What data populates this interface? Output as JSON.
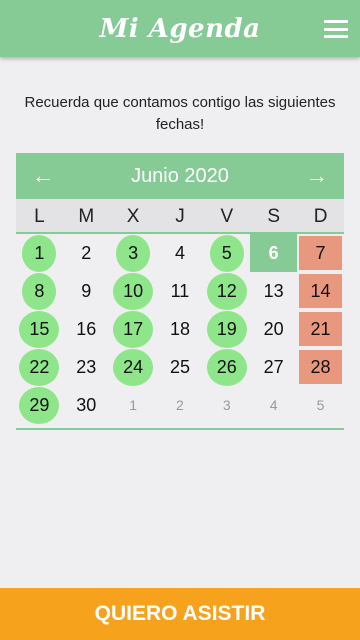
{
  "header": {
    "title": "Mi Agenda",
    "menu_icon": "hamburger-menu-icon"
  },
  "intro": "Recuerda que contamos contigo las siguientes fechas!",
  "calendar": {
    "month_label": "Junio 2020",
    "prev_arrow": "←",
    "next_arrow": "→",
    "weekdays": [
      "L",
      "M",
      "X",
      "J",
      "V",
      "S",
      "D"
    ],
    "days": [
      {
        "n": "1",
        "type": "green"
      },
      {
        "n": "2",
        "type": "normal"
      },
      {
        "n": "3",
        "type": "green"
      },
      {
        "n": "4",
        "type": "normal"
      },
      {
        "n": "5",
        "type": "green"
      },
      {
        "n": "6",
        "type": "today"
      },
      {
        "n": "7",
        "type": "sunday"
      },
      {
        "n": "8",
        "type": "green"
      },
      {
        "n": "9",
        "type": "normal"
      },
      {
        "n": "10",
        "type": "green"
      },
      {
        "n": "11",
        "type": "normal"
      },
      {
        "n": "12",
        "type": "green"
      },
      {
        "n": "13",
        "type": "normal"
      },
      {
        "n": "14",
        "type": "sunday"
      },
      {
        "n": "15",
        "type": "green"
      },
      {
        "n": "16",
        "type": "normal"
      },
      {
        "n": "17",
        "type": "green"
      },
      {
        "n": "18",
        "type": "normal"
      },
      {
        "n": "19",
        "type": "green"
      },
      {
        "n": "20",
        "type": "normal"
      },
      {
        "n": "21",
        "type": "sunday"
      },
      {
        "n": "22",
        "type": "green"
      },
      {
        "n": "23",
        "type": "normal"
      },
      {
        "n": "24",
        "type": "green"
      },
      {
        "n": "25",
        "type": "normal"
      },
      {
        "n": "26",
        "type": "green"
      },
      {
        "n": "27",
        "type": "normal"
      },
      {
        "n": "28",
        "type": "sunday"
      },
      {
        "n": "29",
        "type": "green"
      },
      {
        "n": "30",
        "type": "normal"
      },
      {
        "n": "1",
        "type": "other"
      },
      {
        "n": "2",
        "type": "other"
      },
      {
        "n": "3",
        "type": "other"
      },
      {
        "n": "4",
        "type": "other"
      },
      {
        "n": "5",
        "type": "other"
      }
    ]
  },
  "footer": {
    "button_label": "QUIERO ASISTIR"
  },
  "colors": {
    "primary": "#86cb96",
    "green_day": "#8ee58a",
    "sunday": "#e99880",
    "accent": "#f7a21d"
  }
}
